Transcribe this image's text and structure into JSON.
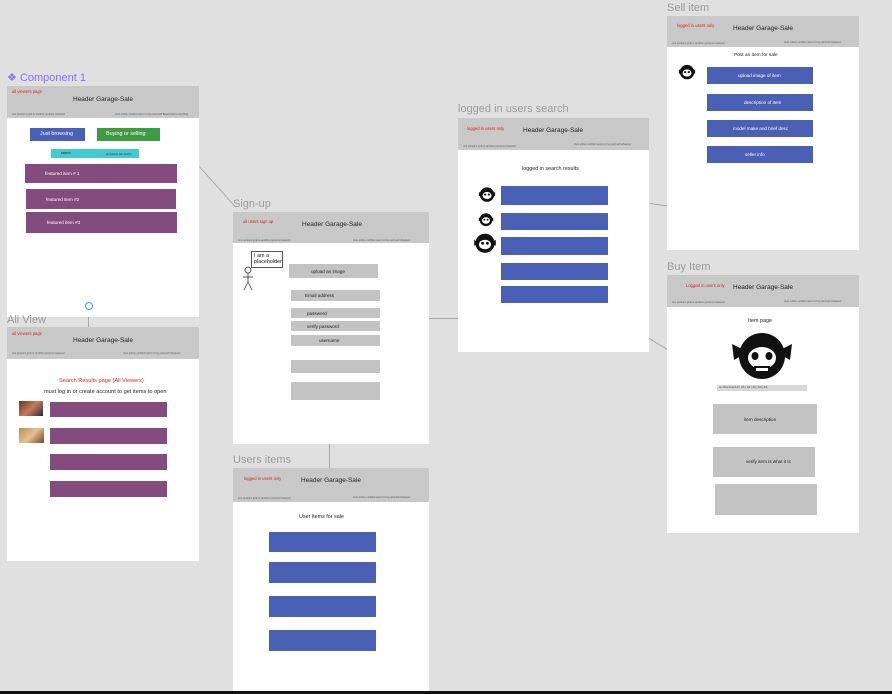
{
  "canvas": {
    "background": "#e0e0e0"
  },
  "component_label": "Component 1",
  "frames": {
    "home": {
      "header": {
        "red": "all viewers page",
        "title": "Header Garage-Sale",
        "left_small": "one person's junk is another persons treasure!",
        "right_small": "trust online verified users to buy and sell/ Buyers/sell everything"
      },
      "just_browsing": "Just browsing",
      "buying_selling": "Buying or selling",
      "search_label": "search",
      "search_hint": "all viewers can search",
      "featured": [
        "featured item # 1",
        "featured item #2",
        "featured item #3"
      ]
    },
    "all_view": {
      "label": "All View",
      "header": {
        "red": "all viewers page",
        "title": "Header Garage-Sale",
        "left_small": "one persons junk is another persons treasure!",
        "right_small": "trust online verified users to buy and sell whatever"
      },
      "results_title": "Search Results page (All Viewers)",
      "login_note": "must log in or create account to get items to open"
    },
    "signup": {
      "label": "Sign-up",
      "header": {
        "red": "all users sign up",
        "title": "Header Garage-Sale",
        "left_small": "one persons junk is another persons treasure!",
        "right_small": "trust online verified users to buy and sell whatever"
      },
      "placeholder_note": "I am a placeholder",
      "upload_image": "upload an image",
      "email": "Email address",
      "password": "password",
      "verify_password": "verify password",
      "username": "username"
    },
    "users_items": {
      "label": "Users items",
      "header": {
        "red": "logged in users only",
        "title": "Header Garage-Sale",
        "left_small": "one persons junk is another persons treasure!",
        "right_small": "trust online verified users to buy and sell whatever"
      },
      "title": "User items for sale"
    },
    "logged_search": {
      "label": "logged in users search",
      "header": {
        "red": "logged in users only",
        "title": "Header Garage-Sale",
        "left_small": "one persons junk is another persons treasure!",
        "right_small": "trust online verified users to buy and sell whatever"
      },
      "title": "logged in search results"
    },
    "sell_item": {
      "label": "Sell item",
      "header": {
        "red": "logged in users only",
        "title": "Header Garage-Sale",
        "left_small": "one persons junk is another persons treasure!",
        "right_small": "trust online verified users to buy and sell whatever"
      },
      "post_title": "Post an item for sale",
      "fields": [
        "upload image of item",
        "description of item",
        "model make and brief desc",
        "seller info"
      ]
    },
    "buy_item": {
      "label": "Buy Item",
      "header": {
        "red": "Logged in users only",
        "title": "Header Garage-Sale",
        "left_small": "one persons junk is another persons treasure!",
        "right_small": "trust online verified users to buy and sell whatever"
      },
      "item_page": "Item page",
      "item_description": "item description",
      "verify": "verify item is what it is",
      "strip": "set thumbnail 1/6 | 2/6 | 3/6 | 4/6 | 5/6 | 6/6"
    }
  },
  "colors": {
    "blue": "#4a60b4",
    "purple": "#844b7e",
    "green": "#3f9a43",
    "cyan": "#44c8d2",
    "header": "#c8c8c8",
    "gray_field": "#c3c3c3",
    "red_text": "#e02020",
    "component": "#8a6cff"
  }
}
